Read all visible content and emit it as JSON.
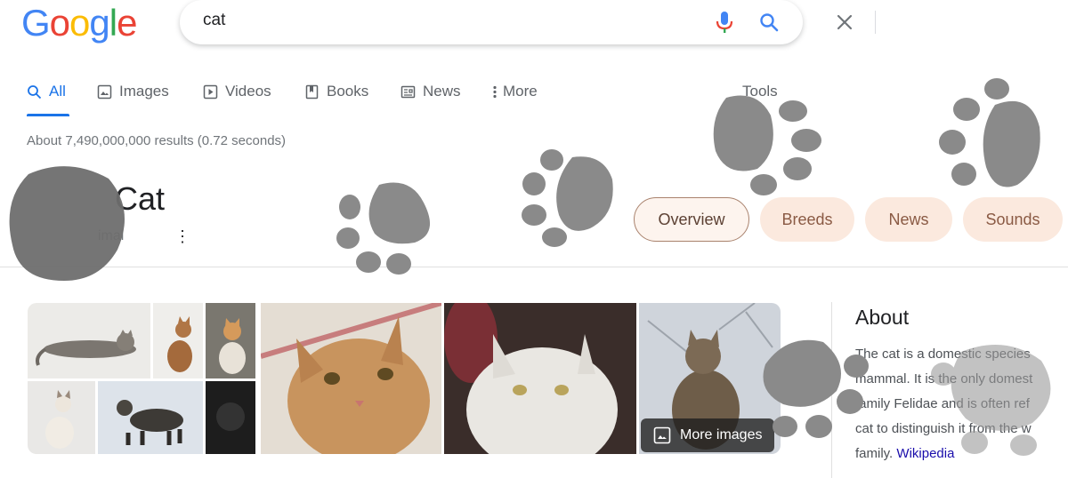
{
  "logo": {
    "letters": [
      "G",
      "o",
      "o",
      "g",
      "l",
      "e"
    ],
    "colors": [
      "#4285F4",
      "#EA4335",
      "#FBBC05",
      "#4285F4",
      "#34A853",
      "#EA4335"
    ]
  },
  "search": {
    "query": "cat",
    "clear_icon": "close-icon",
    "voice_icon": "mic-icon",
    "search_icon": "search-icon"
  },
  "tabs": [
    {
      "label": "All",
      "icon": "search-icon",
      "active": true
    },
    {
      "label": "Images",
      "icon": "image-icon"
    },
    {
      "label": "Videos",
      "icon": "play-icon"
    },
    {
      "label": "Books",
      "icon": "book-icon"
    },
    {
      "label": "News",
      "icon": "news-icon"
    },
    {
      "label": "More",
      "icon": "more-vert-icon"
    },
    {
      "label": "Tools"
    }
  ],
  "results_stats": "About 7,490,000,000 results (0.72 seconds)",
  "knowledge": {
    "title": "Cat",
    "subtitle": "imal",
    "menu": "⋮",
    "chips": [
      {
        "label": "Overview",
        "active": true
      },
      {
        "label": "Breeds"
      },
      {
        "label": "News"
      },
      {
        "label": "Sounds"
      }
    ]
  },
  "images": {
    "more_label": "More images"
  },
  "about": {
    "heading": "About",
    "lines": [
      "The cat is a domestic species",
      "mammal. It is the only domest",
      "family Felidae and is often ref",
      "cat to distinguish it from the w"
    ],
    "last_line": "family.",
    "source_link": "Wikipedia"
  },
  "colors": {
    "accent": "#1a73e8",
    "paw": "#8a8a8a",
    "chip_bg": "#fbe9de",
    "link": "#1a0dab"
  }
}
